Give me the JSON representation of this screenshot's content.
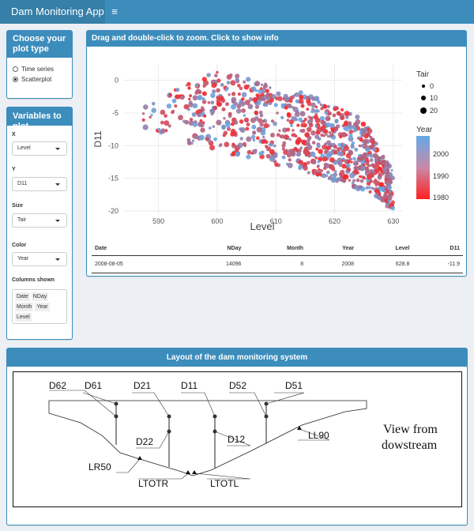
{
  "app": {
    "title": "Dam Monitoring App",
    "menu_icon": "≡"
  },
  "plot_type": {
    "heading": "Choose your plot type",
    "options": [
      {
        "label": "Time series",
        "selected": false
      },
      {
        "label": "Scatterplot",
        "selected": true
      }
    ]
  },
  "variables": {
    "heading": "Variables to plot",
    "x": {
      "label": "X",
      "value": "Level"
    },
    "y": {
      "label": "Y",
      "value": "D11"
    },
    "size": {
      "label": "Size",
      "value": "Tair"
    },
    "color": {
      "label": "Color",
      "value": "Year"
    },
    "columns": {
      "label": "Columns shown",
      "chips": [
        "Date",
        "NDay",
        "Month",
        "Year",
        "Level"
      ]
    }
  },
  "main": {
    "heading": "Drag and double-click to zoom. Click to show info"
  },
  "chart_data": {
    "type": "scatter",
    "xlabel": "Level",
    "ylabel": "D11",
    "xlim": [
      584,
      631.5
    ],
    "ylim": [
      -20.5,
      2.5
    ],
    "x_ticks": [
      "590",
      "600",
      "610",
      "620",
      "630"
    ],
    "y_ticks": [
      "0",
      "-5",
      "-10",
      "-15",
      "-20"
    ],
    "legend_size": {
      "title": "Tair",
      "entries": [
        "0",
        "10",
        "20"
      ]
    },
    "legend_color": {
      "title": "Year",
      "ticks": [
        "2000",
        "1990",
        "1980"
      ],
      "low_color": "#ff2020",
      "high_color": "#63a9e6"
    },
    "grid": true,
    "points_note": "approx 1700 points, dense crescent band from Level 586 to 630, D11 from about 2 to -20"
  },
  "info_table": {
    "columns": [
      "Date",
      "NDay",
      "Month",
      "Year",
      "Level",
      "D11"
    ],
    "rows": [
      [
        "2008-08-05",
        "14096",
        "8",
        "2008",
        "628.8",
        "-11.9"
      ]
    ]
  },
  "layout": {
    "heading": "Layout of the dam monitoring system",
    "labels": [
      "D62",
      "D61",
      "D21",
      "D11",
      "D52",
      "D51",
      "D22",
      "D12",
      "LL90",
      "LR50",
      "LTOTR",
      "LTOTL"
    ],
    "view_line1": "View from",
    "view_line2": "dowstream"
  }
}
